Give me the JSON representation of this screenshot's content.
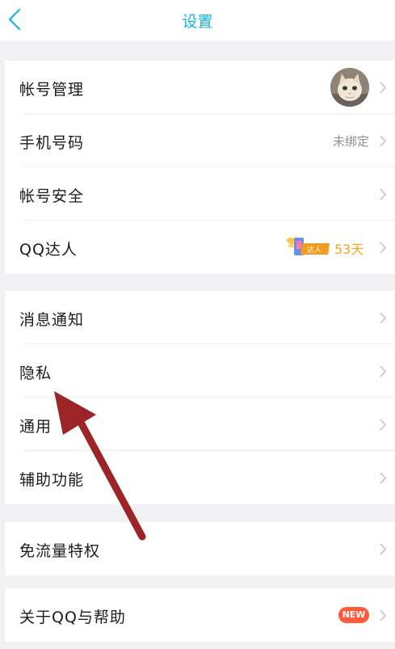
{
  "header": {
    "title": "设置"
  },
  "groups": [
    {
      "rows": [
        {
          "label": "帐号管理"
        },
        {
          "label": "手机号码",
          "value": "未绑定"
        },
        {
          "label": "帐号安全"
        },
        {
          "label": "QQ达人",
          "badge": {
            "text": "达人",
            "days": "53天"
          }
        }
      ]
    },
    {
      "rows": [
        {
          "label": "消息通知"
        },
        {
          "label": "隐私"
        },
        {
          "label": "通用"
        },
        {
          "label": "辅助功能"
        }
      ]
    },
    {
      "rows": [
        {
          "label": "免流量特权"
        }
      ]
    },
    {
      "rows": [
        {
          "label": "关于QQ与帮助",
          "badge": {
            "text": "NEW"
          }
        }
      ]
    }
  ],
  "colors": {
    "accent": "#14b3e8",
    "background": "#f2f2f5",
    "arrow": "#9b2426",
    "days": "#f5a623",
    "new_badge": "#ff5a3c"
  },
  "icons": {
    "back": "back-chevron-icon",
    "row_chevron": "chevron-right-icon",
    "avatar": "cat-avatar",
    "talent_badge": "winged-talent-badge-icon",
    "annotation": "red-annotation-arrow"
  }
}
